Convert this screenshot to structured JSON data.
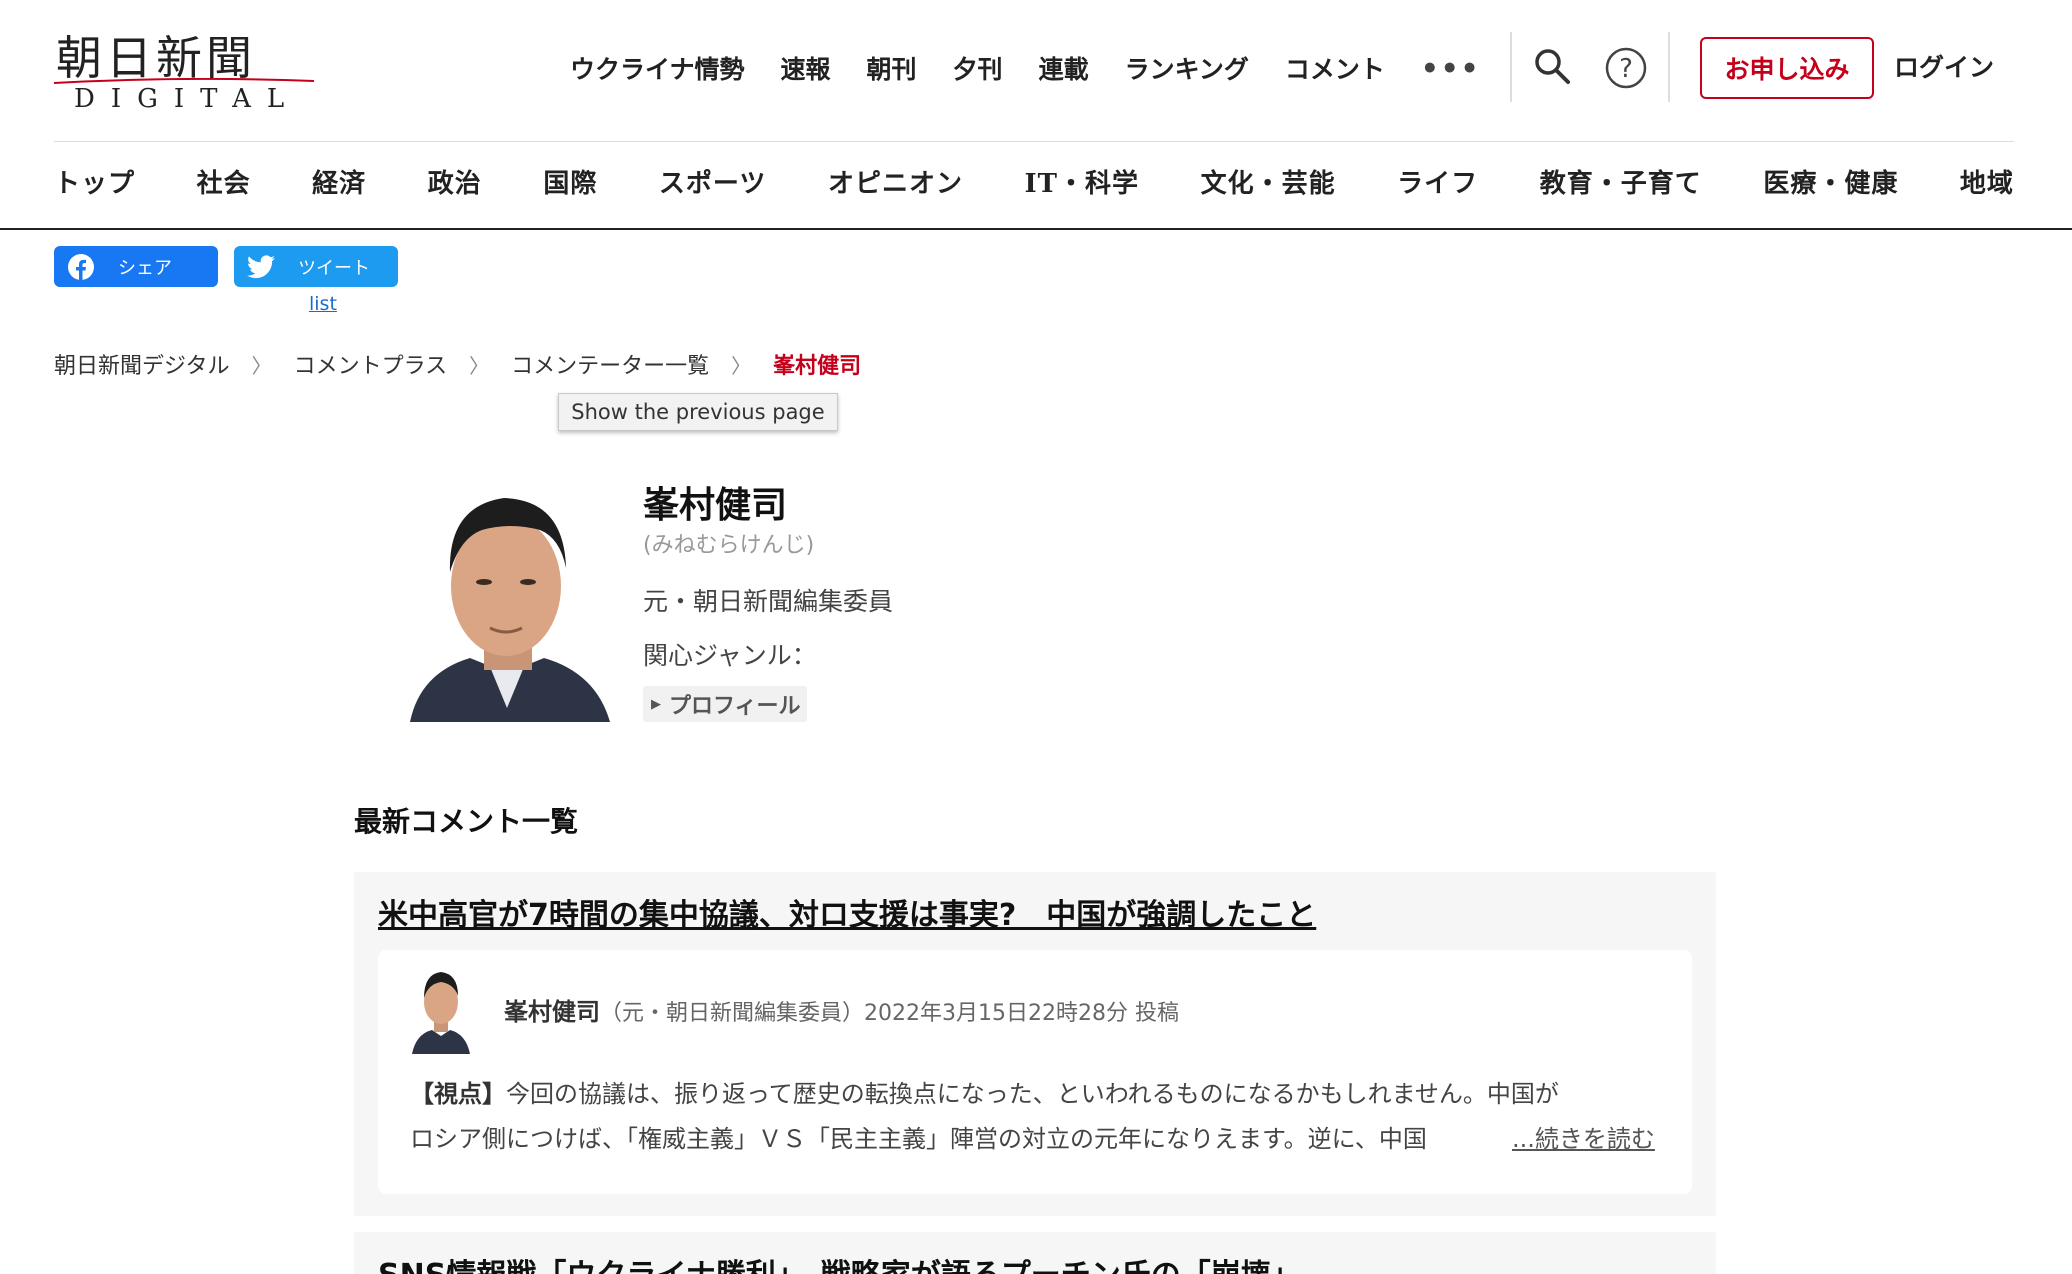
{
  "brand": {
    "logo_main": "朝日新聞",
    "logo_sub": "DIGITAL",
    "accent_color": "#c4001a"
  },
  "topnav": {
    "items": [
      "ウクライナ情勢",
      "速報",
      "朝刊",
      "夕刊",
      "連載",
      "ランキング",
      "コメント"
    ],
    "more": "•••",
    "search_icon": "search-icon",
    "help_icon": "help-icon",
    "apply": "お申し込み",
    "login": "ログイン"
  },
  "categories": [
    "トップ",
    "社会",
    "経済",
    "政治",
    "国際",
    "スポーツ",
    "オピニオン",
    "IT・科学",
    "文化・芸能",
    "ライフ",
    "教育・子育て",
    "医療・健康",
    "地域"
  ],
  "share": {
    "facebook": "シェア",
    "twitter": "ツイート",
    "list_link": "list"
  },
  "breadcrumb": [
    "朝日新聞デジタル",
    "コメントプラス",
    "コメンテーター一覧",
    "峯村健司"
  ],
  "tooltip": "Show the previous page",
  "profile": {
    "name": "峯村健司",
    "kana": "(みねむらけんじ)",
    "title": "元・朝日新聞編集委員",
    "genre_label": "関心ジャンル：",
    "profile_toggle": "プロフィール"
  },
  "comments": {
    "section_title": "最新コメント一覧",
    "items": [
      {
        "article_title": "米中高官が7時間の集中協議、対ロ支援は事実?　中国が強調したこと",
        "author": "峯村健司",
        "author_role": "（元・朝日新聞編集委員）",
        "posted": "2022年3月15日22時28分 投稿",
        "tag": "【視点】",
        "line1": "今回の協議は、振り返って歴史の転換点になった、といわれるものになるかもしれません。中国が",
        "line2": "ロシア側につけば、「権威主義」ＶＳ「民主主義」陣営の対立の元年になりえます。逆に、中国",
        "read_more": "...続きを読む"
      },
      {
        "article_title": "SNS情報戦「ウクライナ勝利」　戦略家が語るプーチン氏の「崩壊」"
      }
    ]
  }
}
